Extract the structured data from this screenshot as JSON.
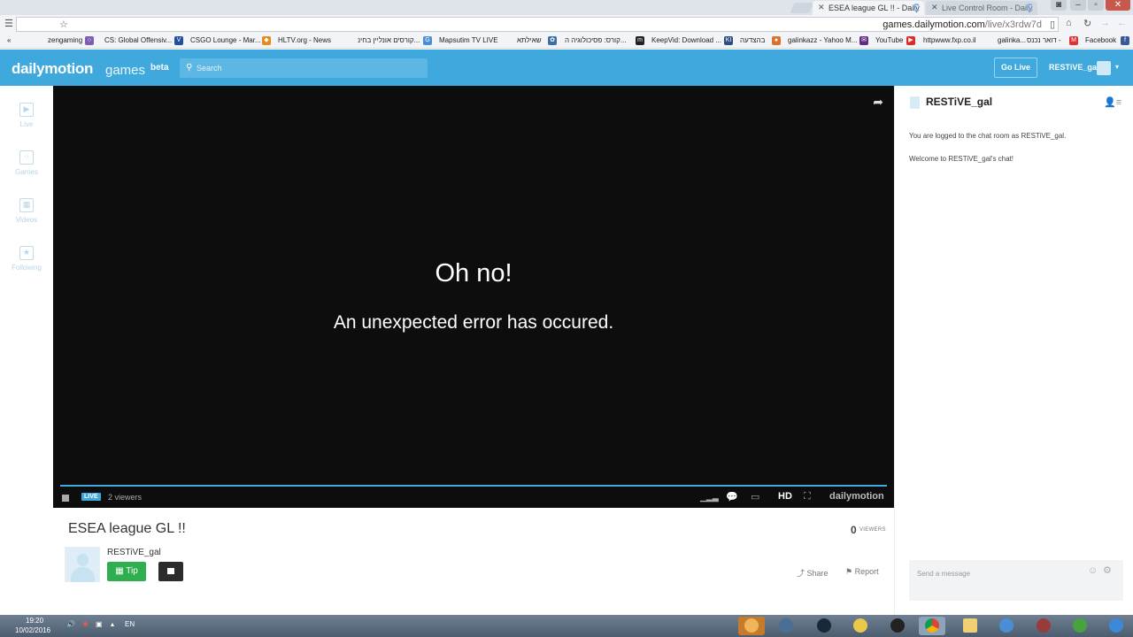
{
  "browser": {
    "tabs": [
      {
        "title": "ESEA league GL !! - Daily",
        "active": true
      },
      {
        "title": "Live Control Room - Daily",
        "active": false
      }
    ],
    "url_host": "games.dailymotion.com",
    "url_path": "/live/x3rdw7d",
    "bookmarks": [
      "zengaming",
      "CS: Global Offensiv...",
      "CSGO Lounge - Mar...",
      "HLTV.org - News",
      "קורסים אונליין בחינ...",
      "Mapsutim TV LIVE",
      "שאילתא",
      "קורס: פסיכולוגיה ה...",
      "KeepVid: Download ...",
      "בהצדעה",
      "galinkazz - Yahoo M...",
      "YouTube",
      "httpwww.fxp.co.il",
      "galinka...",
      "דואר נכנס -",
      "Facebook"
    ],
    "more_bookmarks": "«"
  },
  "site": {
    "logo": "dailymotion",
    "logo_sub": "games",
    "logo_beta": "beta",
    "search_placeholder": "Search",
    "go_live": "Go Live",
    "username": "RESTiVE_gal",
    "nav": [
      {
        "label": "Live",
        "icon": "play-icon"
      },
      {
        "label": "Games",
        "icon": "games-icon"
      },
      {
        "label": "Videos",
        "icon": "videos-icon"
      },
      {
        "label": "Following",
        "icon": "star-icon"
      }
    ]
  },
  "player": {
    "error_title": "Oh no!",
    "error_message": "An unexpected error has occured.",
    "live_badge": "LIVE",
    "viewers_text": "2 viewers",
    "hd_label": "HD",
    "brand": "dailymotion",
    "progress_color": "#3fa9dd"
  },
  "video": {
    "title": "ESEA league GL !!",
    "viewer_count": "0",
    "viewer_label": "VIEWERS",
    "owner": "RESTiVE_gal",
    "tip_label": "Tip",
    "share_label": "Share",
    "report_label": "Report"
  },
  "chat": {
    "room_owner": "RESTiVE_gal",
    "messages": [
      "You are logged to the chat room as RESTiVE_gal.",
      "Welcome to RESTiVE_gal's chat!"
    ],
    "input_placeholder": "Send a message"
  },
  "taskbar": {
    "time": "19:20",
    "date": "10/02/2016",
    "language": "EN"
  },
  "colors": {
    "brand_blue": "#3fa9dd",
    "tip_green": "#2fae4f"
  }
}
